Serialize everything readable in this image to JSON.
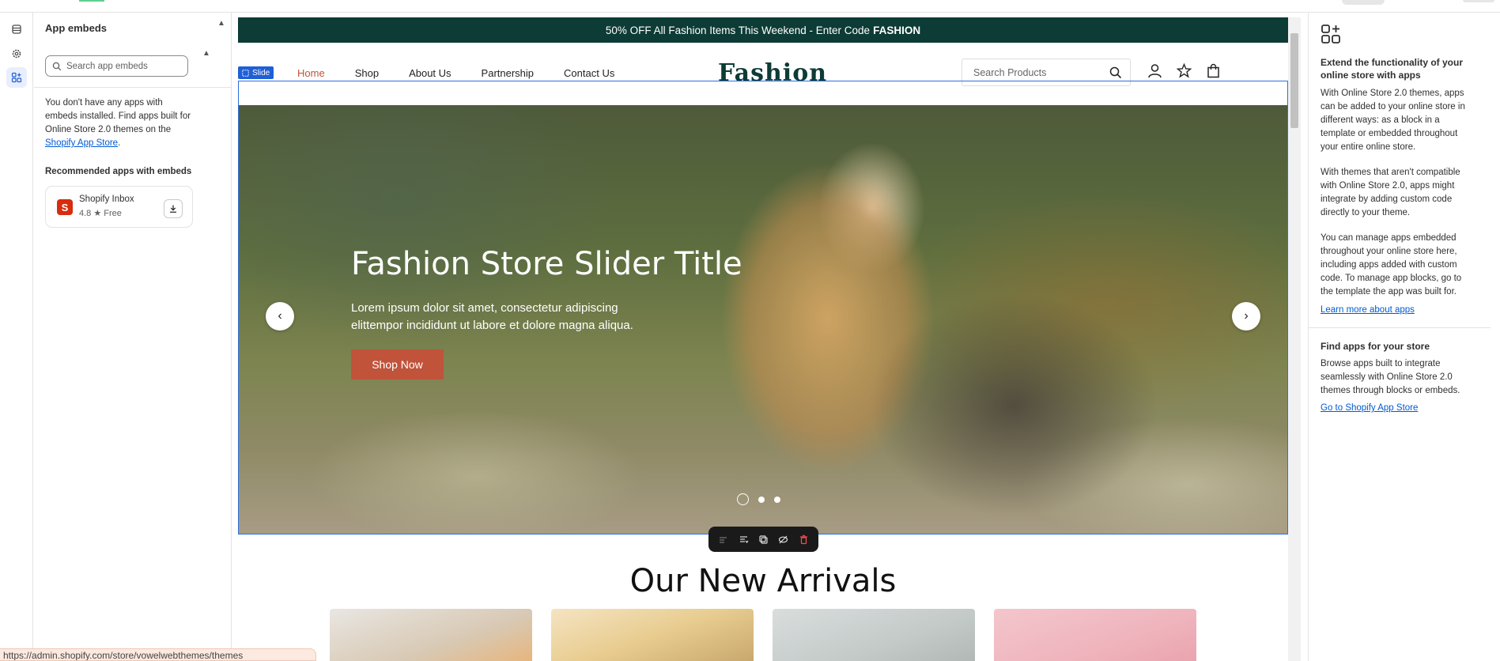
{
  "sidebar": {
    "title": "App embeds",
    "search_placeholder": "Search app embeds",
    "empty_text_before": "You don't have any apps with embeds installed. Find apps built for Online Store 2.0 themes on the ",
    "empty_link": "Shopify App Store",
    "empty_text_after": ".",
    "recommended_title": "Recommended apps with embeds",
    "app": {
      "name": "Shopify Inbox",
      "rating": "4.8",
      "price": "Free",
      "logo_letter": "S"
    }
  },
  "preview": {
    "announcement_text": "50% OFF All Fashion Items This Weekend - Enter Code",
    "announcement_code": "FASHION",
    "section_tag": "Slide",
    "nav": [
      "Home",
      "Shop",
      "About Us",
      "Partnership",
      "Contact Us"
    ],
    "logo": "Fashion",
    "search_placeholder": "Search Products",
    "hero": {
      "title": "Fashion Store Slider Title",
      "subtitle": "Lorem ipsum dolor sit amet, consectetur adipiscing elittempor incididunt ut labore et dolore magna aliqua.",
      "button": "Shop Now"
    },
    "arrivals_title": "Our New Arrivals"
  },
  "help": {
    "h1": "Extend the functionality of your online store with apps",
    "p1": "With Online Store 2.0 themes, apps can be added to your online store in different ways: as a block in a template or embedded throughout your entire online store.",
    "p2": "With themes that aren't compatible with Online Store 2.0, apps might integrate by adding custom code directly to your theme.",
    "p3": "You can manage apps embedded throughout your online store here, including apps added with custom code. To manage app blocks, go to the template the app was built for.",
    "link1": "Learn more about apps",
    "h2": "Find apps for your store",
    "p4": "Browse apps built to integrate seamlessly with Online Store 2.0 themes through blocks or embeds.",
    "link2": "Go to Shopify App Store"
  },
  "status_url": "https://admin.shopify.com/store/vowelwebthemes/themes",
  "colors": {
    "accent": "#c0533a",
    "brand_dark": "#0d3b36",
    "link": "#005bd3",
    "selection": "#2e6fe0"
  }
}
